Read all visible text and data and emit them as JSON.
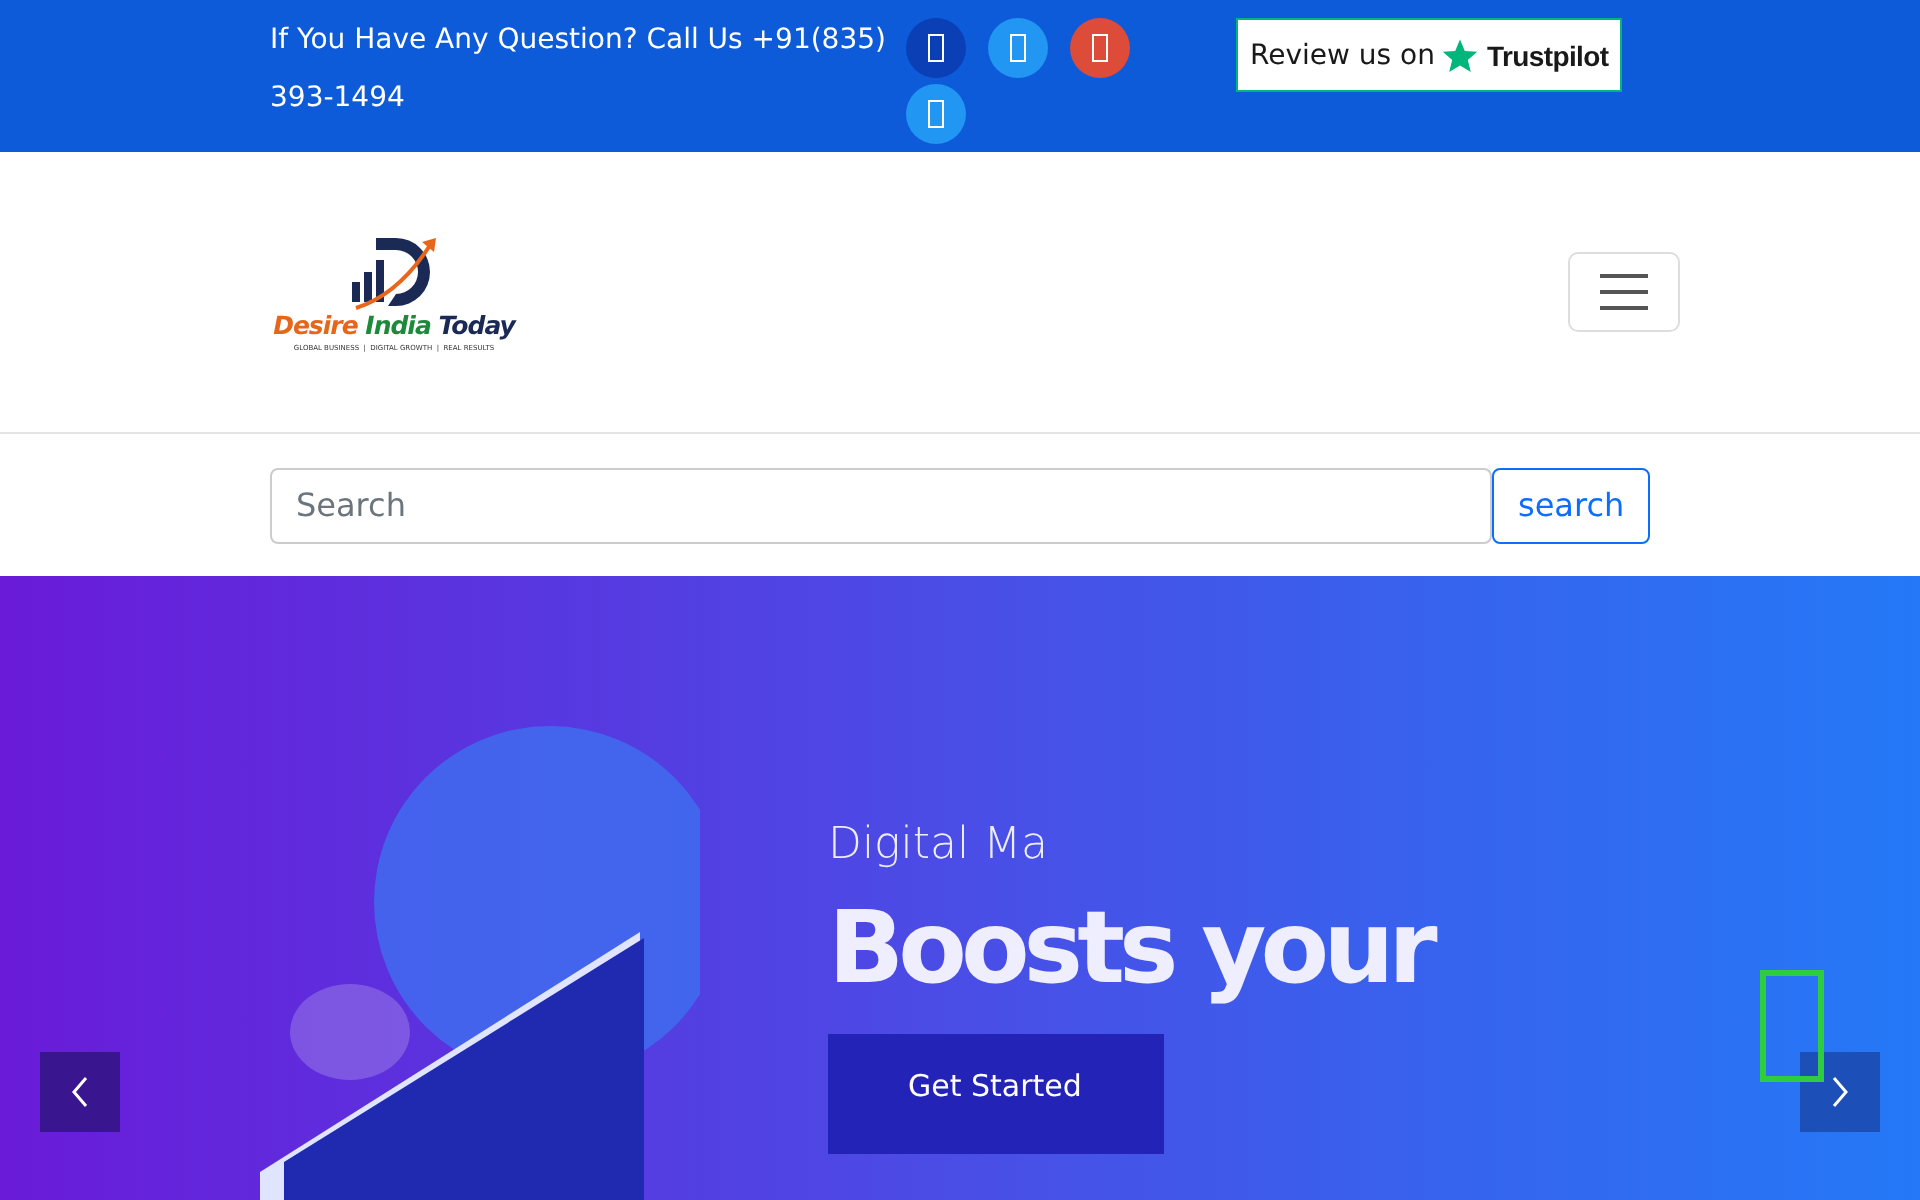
{
  "topbar": {
    "contact": "If You Have Any Question? Call Us +91(835) 393-1494",
    "social": [
      {
        "color": "#0a3fb5"
      },
      {
        "color": "#2196f3"
      },
      {
        "color": "#dd4b39"
      },
      {
        "color": "#2196f3"
      }
    ],
    "review": {
      "label": "Review us on",
      "brand": "Trustpilot"
    }
  },
  "header": {
    "logo": {
      "name_parts": [
        "Desire",
        "India",
        "Today"
      ],
      "tagline": "GLOBAL BUSINESS  |  DIGITAL GROWTH  |  REAL RESULTS"
    }
  },
  "search": {
    "placeholder": "Search",
    "button": "search"
  },
  "hero": {
    "kicker": "Digital Ma",
    "headline": "Boosts your",
    "cta": "Get Started"
  }
}
